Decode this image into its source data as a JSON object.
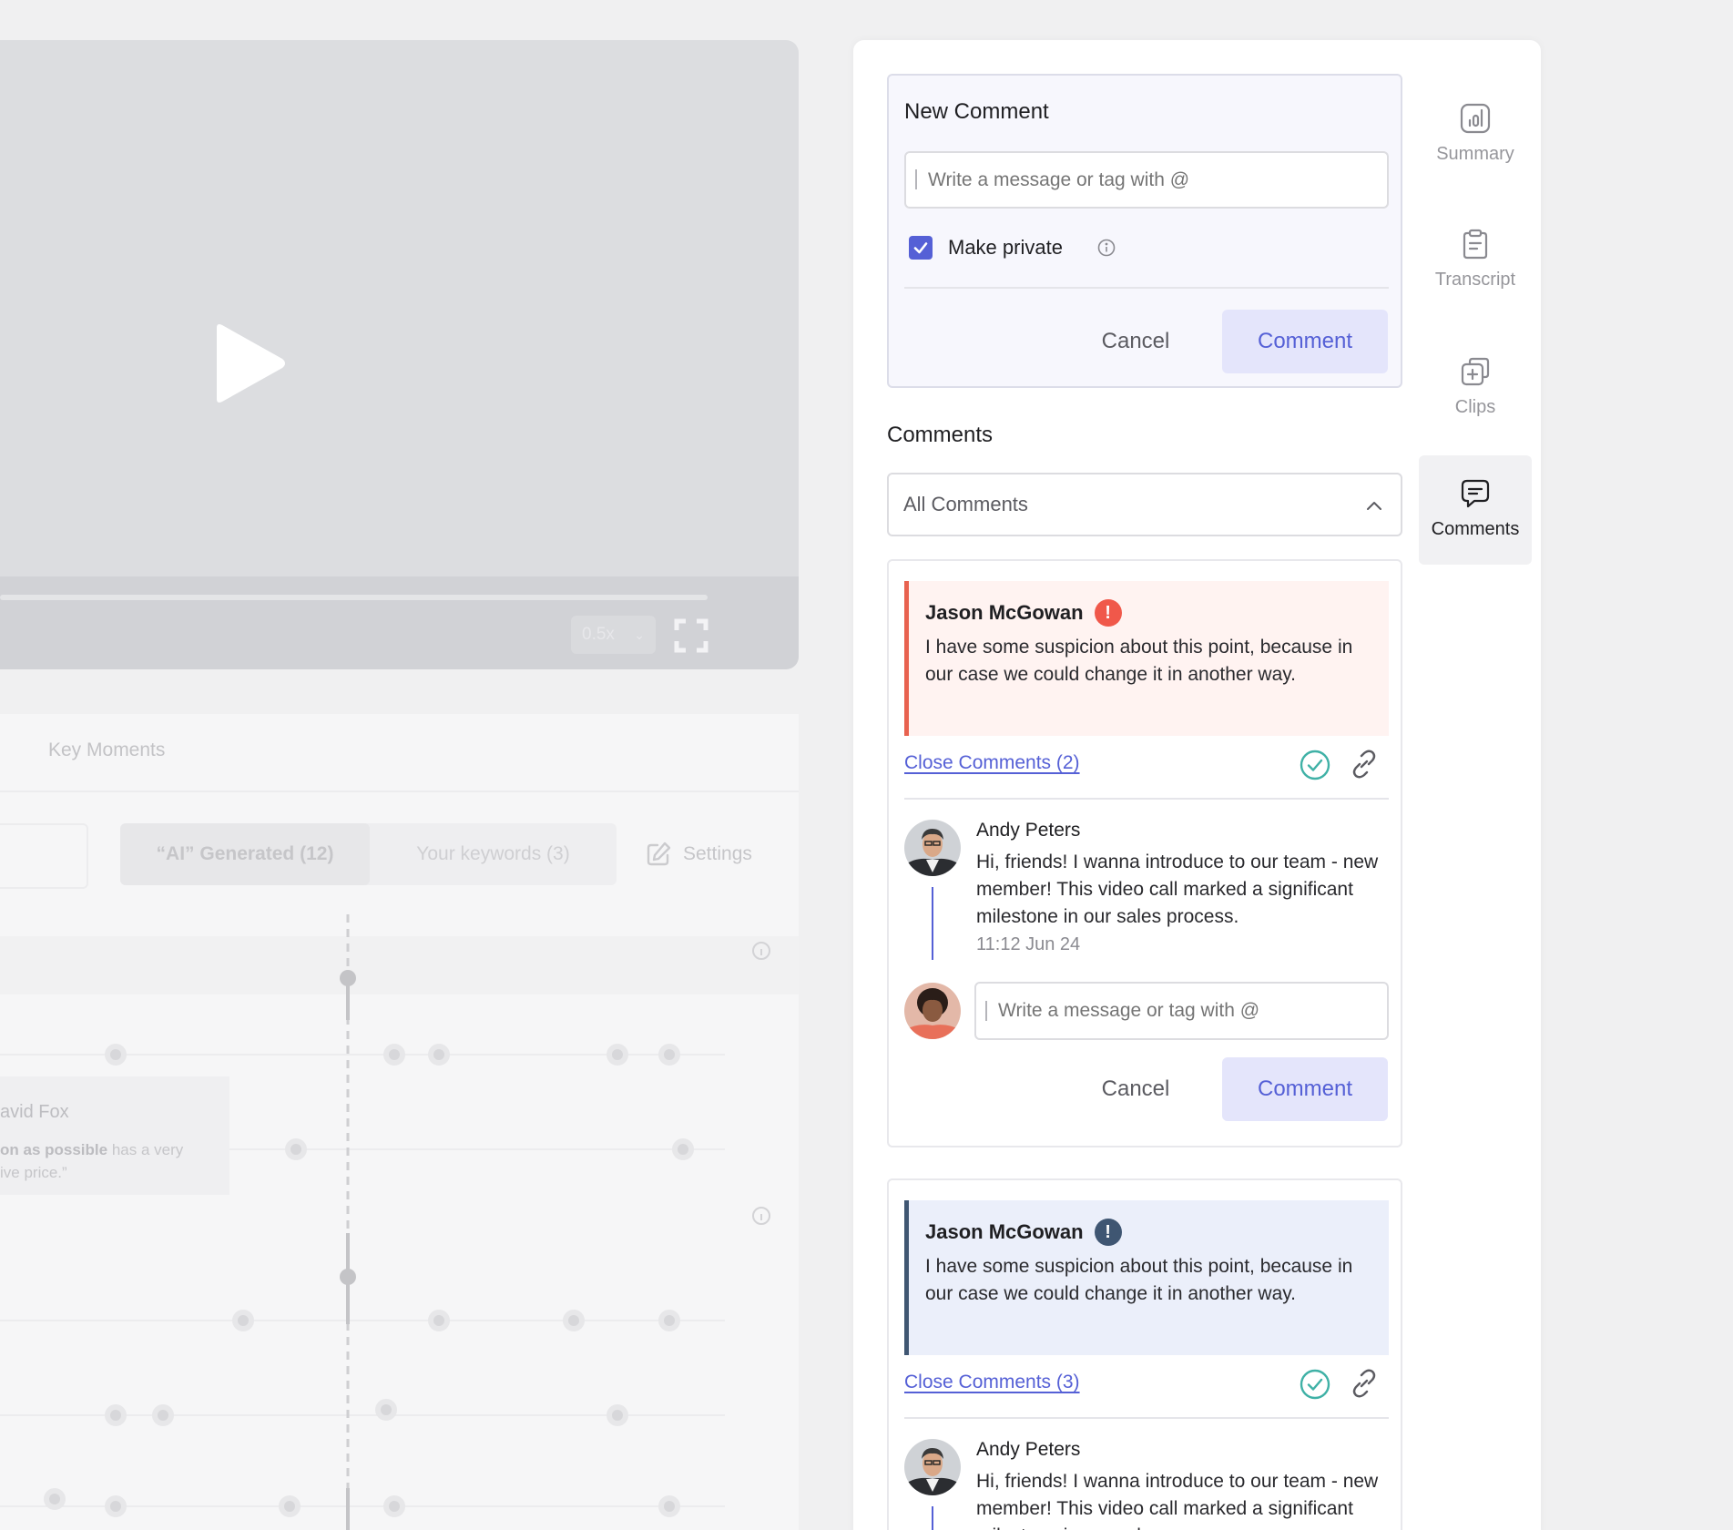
{
  "video": {
    "speed": "0.5x"
  },
  "key_moments": {
    "title": "Key Moments",
    "tab_ai": "“AI” Generated (12)",
    "tab_keywords": "Your keywords (3)",
    "settings_label": "Settings",
    "quote_name": "avid Fox",
    "quote_bold": "on as possible",
    "quote_rest": " has a very",
    "quote_line2": "ive price.”"
  },
  "new_comment": {
    "title": "New Comment",
    "placeholder": "Write a message or tag with @",
    "private_label": "Make private",
    "cancel_label": "Cancel",
    "comment_label": "Comment"
  },
  "comments": {
    "title": "Comments",
    "filter_value": "All Comments",
    "threads": [
      {
        "author": "Jason McGowan",
        "text": "I have some suspicion about this point, because in our case we could change it in another way.",
        "close_label": "Close Comments (2)",
        "reply_author": "Andy Peters",
        "reply_text": "Hi, friends! I wanna introduce to our team - new member! This video call marked a significant milestone in our sales process.",
        "reply_time": "11:12 Jun 24",
        "reply_placeholder": "Write a message or tag with @",
        "cancel_label": "Cancel",
        "comment_label": "Comment"
      },
      {
        "author": "Jason McGowan",
        "text": "I have some suspicion about this point, because in our case we could change it in another way.",
        "close_label": "Close Comments (3)",
        "reply_author": "Andy Peters",
        "reply_text": "Hi, friends! I wanna introduce to our team - new member! This video call marked a significant milestone in our sales process."
      }
    ]
  },
  "side_nav": {
    "summary": "Summary",
    "transcript": "Transcript",
    "clips": "Clips",
    "comments": "Comments"
  },
  "colors": {
    "accent": "#5560d6",
    "accent_soft": "#e4e5fb",
    "alert_red": "#f0584a",
    "alert_blue": "#3f5672",
    "resolve_teal": "#3fb1a6"
  },
  "icons": [
    "play-icon",
    "fullscreen-icon",
    "pencil-icon",
    "info-icon",
    "check-icon",
    "chevron-up-icon",
    "alert-icon",
    "resolve-check-icon",
    "link-icon",
    "summary-chart-icon",
    "transcript-icon",
    "clips-icon",
    "comments-icon"
  ]
}
